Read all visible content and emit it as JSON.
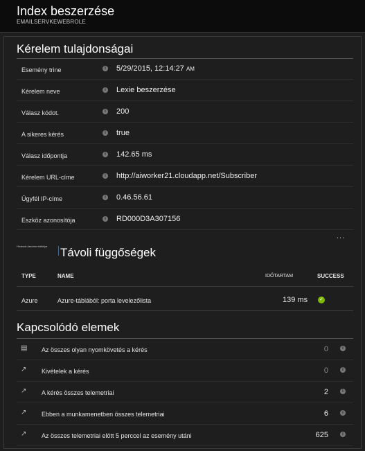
{
  "header": {
    "title": "Index beszerzése",
    "subtitle": "EMAILSERVKEWEBROLE"
  },
  "request_properties": {
    "title": "Kérelem tulajdonságai",
    "rows": [
      {
        "label": "Esemény trine",
        "value": "5/29/2015, 12:14:27",
        "suffix": "AM"
      },
      {
        "label": "Kérelem neve",
        "value": "Lexie beszerzése"
      },
      {
        "label": "Válasz kódot.",
        "value": "200"
      },
      {
        "label": "A sikeres kérés",
        "value": "true"
      },
      {
        "label": "Válasz időpontja",
        "value": "142.65 ms"
      },
      {
        "label": "Kérelem URL-címe",
        "value": "http://aiworker21.cloudapp.net/Subscriber"
      },
      {
        "label": "Ügyfél IP-címe",
        "value": "0.46.56.61"
      },
      {
        "label": "Eszköz azonosítója",
        "value": "RD000D3A307156"
      }
    ],
    "more": "..."
  },
  "dependencies": {
    "side_label": "Hívások összmunkafolya",
    "title": "Távoli függőségek",
    "columns": {
      "type": "TYPE",
      "name": "NAME",
      "duration": "IDŐTARTAM",
      "success": "SUCCESS"
    },
    "rows": [
      {
        "type": "Azure",
        "name": "Azure-táblából: porta levelezőlista",
        "duration": "139 ms",
        "success": true
      }
    ]
  },
  "related": {
    "title": "Kapcsolódó elemek",
    "items": [
      {
        "icon": "document-icon",
        "label": "Az összes olyan nyomkövetés a kérés",
        "count": "0"
      },
      {
        "icon": "arrow-icon",
        "label": "Kivételek a kérés",
        "count": "0"
      },
      {
        "icon": "arrow-icon",
        "label": "A kérés összes telemetriai",
        "count": "2"
      },
      {
        "icon": "arrow-icon",
        "label": "Ebben a munkamenetben összes telemetriai",
        "count": "6"
      },
      {
        "icon": "arrow-icon",
        "label": "Az összes telemetriai elött 5 perccel az esemény utáni",
        "count": "625"
      }
    ]
  },
  "colors": {
    "background": "#1e1e1e",
    "header": "#0c0c0c",
    "success": "#7fba00"
  }
}
